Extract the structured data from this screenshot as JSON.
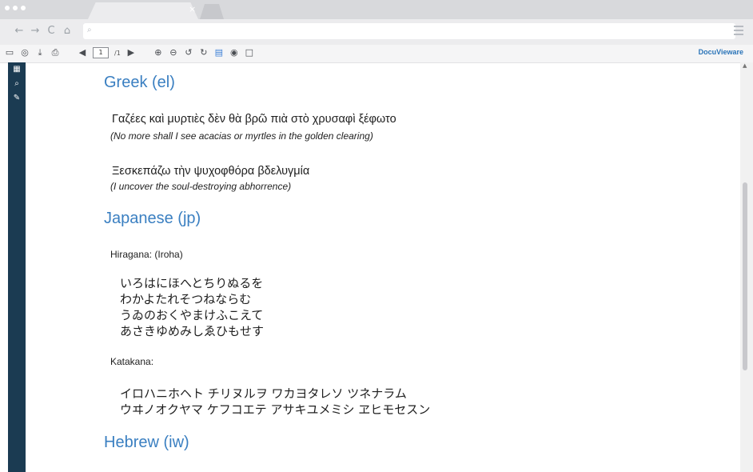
{
  "browser": {
    "tab_close": "×",
    "nav_icons": [
      "←",
      "→",
      "C",
      "⌂"
    ]
  },
  "toolbar": {
    "page_current": "1",
    "page_total": "/1",
    "brand": "DocuVieware"
  },
  "content": {
    "greek_heading": "Greek (el)",
    "greek_line1": "Γαζέες καὶ μυρτιὲς δὲν θὰ βρῶ πιὰ στὸ χρυσαφὶ ξέφωτο",
    "greek_trans1": "(No more shall I see acacias or myrtles in the golden clearing)",
    "greek_line2": "Ξεσκεπάζω τὴν ψυχοφθόρα βδελυγμία",
    "greek_trans2": "(I uncover the soul-destroying abhorrence)",
    "japanese_heading": "Japanese (jp)",
    "hiragana_label": "Hiragana: (Iroha)",
    "hiragana_lines": [
      "いろはにほへとちりぬるを",
      "わかよたれそつねならむ",
      "うゐのおくやまけふこえて",
      "あさきゆめみしゑひもせす"
    ],
    "katakana_label": "Katakana:",
    "katakana_lines": [
      "イロハニホヘト チリヌルヲ ワカヨタレソ ツネナラム",
      "ウヰノオクヤマ ケフコエテ アサキユメミシ ヱヒモセスン"
    ],
    "hebrew_heading": "Hebrew (iw)"
  },
  "colors": {
    "heading": "#3a7fc1",
    "sidebar": "#1b3b52",
    "brand": "#2a74b8"
  }
}
